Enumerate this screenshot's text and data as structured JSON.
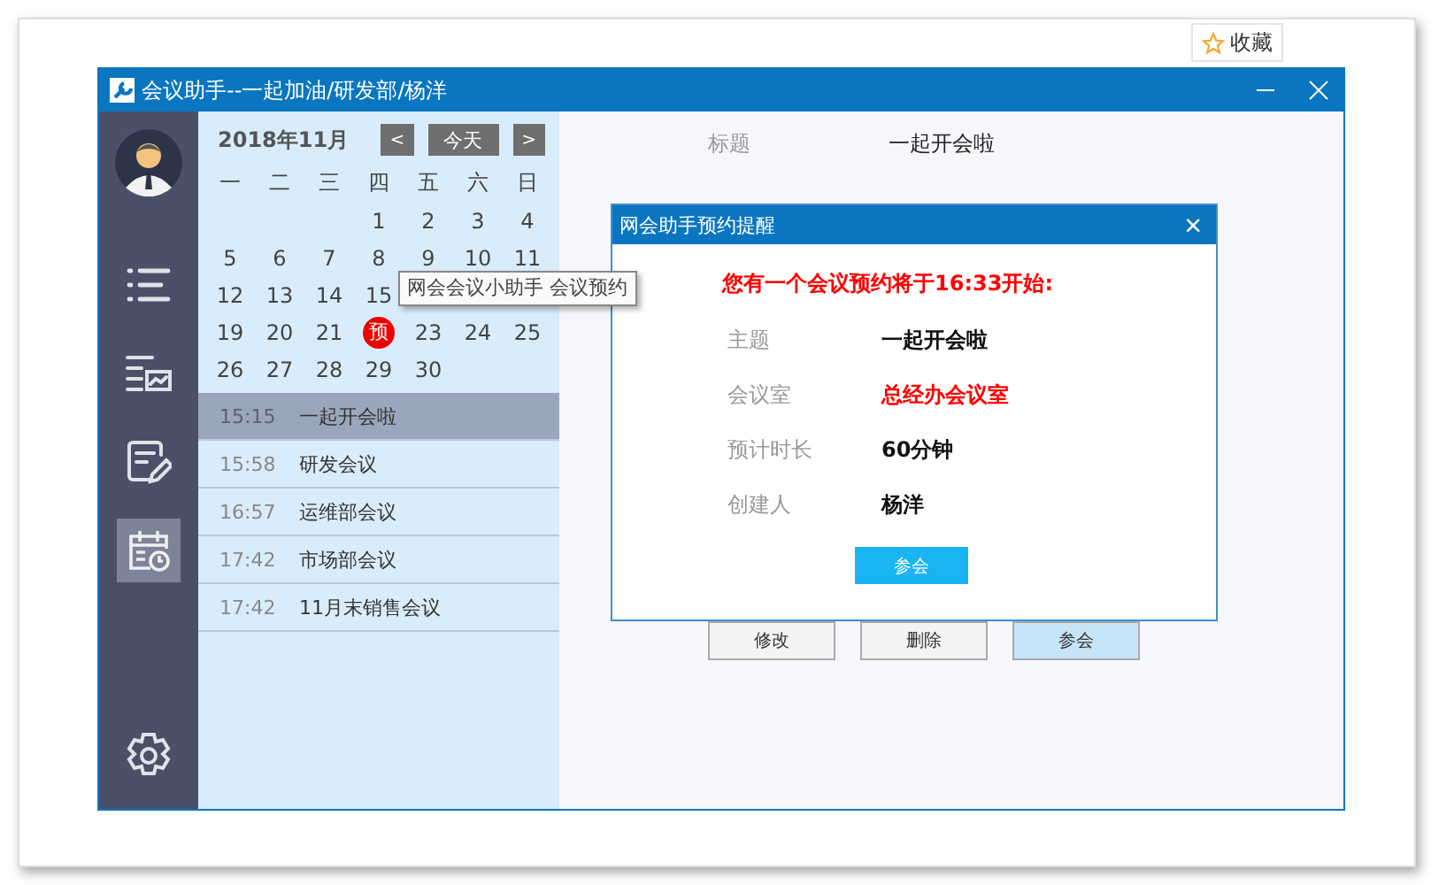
{
  "favorite_button": {
    "label": "收藏"
  },
  "window": {
    "title": "会议助手--一起加油/研发部/杨洋"
  },
  "sidebar": {
    "items": [
      {
        "kind": "avatar",
        "selected": false
      },
      {
        "kind": "list",
        "selected": false
      },
      {
        "kind": "report",
        "selected": false
      },
      {
        "kind": "edit",
        "selected": false
      },
      {
        "kind": "calendar",
        "selected": true
      },
      {
        "kind": "settings",
        "selected": false
      }
    ]
  },
  "calendar": {
    "month": "2018年11月",
    "prev": "<",
    "today": "今天",
    "next": ">",
    "weekdays": [
      "一",
      "二",
      "三",
      "四",
      "五",
      "六",
      "日"
    ],
    "weeks": [
      [
        {
          "kind": "blank"
        },
        {
          "kind": "blank"
        },
        {
          "kind": "blank"
        },
        {
          "kind": "day",
          "text": "1"
        },
        {
          "kind": "day",
          "text": "2"
        },
        {
          "kind": "day",
          "text": "3"
        },
        {
          "kind": "day",
          "text": "4"
        }
      ],
      [
        {
          "kind": "day",
          "text": "5"
        },
        {
          "kind": "day",
          "text": "6"
        },
        {
          "kind": "day",
          "text": "7"
        },
        {
          "kind": "day",
          "text": "8"
        },
        {
          "kind": "day",
          "text": "9"
        },
        {
          "kind": "day",
          "text": "10"
        },
        {
          "kind": "day",
          "text": "11"
        }
      ],
      [
        {
          "kind": "day",
          "text": "12"
        },
        {
          "kind": "day",
          "text": "13"
        },
        {
          "kind": "day",
          "text": "14"
        },
        {
          "kind": "day",
          "text": "15"
        },
        {
          "kind": "covered"
        },
        {
          "kind": "covered"
        },
        {
          "kind": "covered"
        }
      ],
      [
        {
          "kind": "day",
          "text": "19"
        },
        {
          "kind": "day",
          "text": "20"
        },
        {
          "kind": "day",
          "text": "21"
        },
        {
          "kind": "reserved",
          "text": "预"
        },
        {
          "kind": "day",
          "text": "23"
        },
        {
          "kind": "day",
          "text": "24"
        },
        {
          "kind": "day",
          "text": "25"
        }
      ],
      [
        {
          "kind": "day",
          "text": "26"
        },
        {
          "kind": "day",
          "text": "27"
        },
        {
          "kind": "day",
          "text": "28"
        },
        {
          "kind": "day",
          "text": "29"
        },
        {
          "kind": "day",
          "text": "30"
        },
        {
          "kind": "blank"
        },
        {
          "kind": "blank"
        }
      ]
    ]
  },
  "tooltip": {
    "text": "网会会议小助手 会议预约"
  },
  "meetings": [
    {
      "time": "15:15",
      "title": "一起开会啦",
      "selected": true
    },
    {
      "time": "15:58",
      "title": "研发会议",
      "selected": false
    },
    {
      "time": "16:57",
      "title": "运维部会议",
      "selected": false
    },
    {
      "time": "17:42",
      "title": "市场部会议",
      "selected": false
    },
    {
      "time": "17:42",
      "title": "11月末销售会议",
      "selected": false
    }
  ],
  "detail": {
    "label": "标题",
    "value": "一起开会啦",
    "buttons": [
      {
        "label": "修改",
        "selected": false
      },
      {
        "label": "删除",
        "selected": false
      },
      {
        "label": "参会",
        "selected": true
      }
    ]
  },
  "dialog": {
    "title": "网会助手预约提醒",
    "close": "×",
    "message": "您有一个会议预约将于16:33开始:",
    "fields": [
      {
        "label": "主题",
        "value": "一起开会啦",
        "highlight": false
      },
      {
        "label": "会议室",
        "value": "总经办会议室",
        "highlight": true
      },
      {
        "label": "预计时长",
        "value": "60分钟",
        "highlight": false
      },
      {
        "label": "创建人",
        "value": "杨洋",
        "highlight": false
      }
    ],
    "button": "参会"
  }
}
